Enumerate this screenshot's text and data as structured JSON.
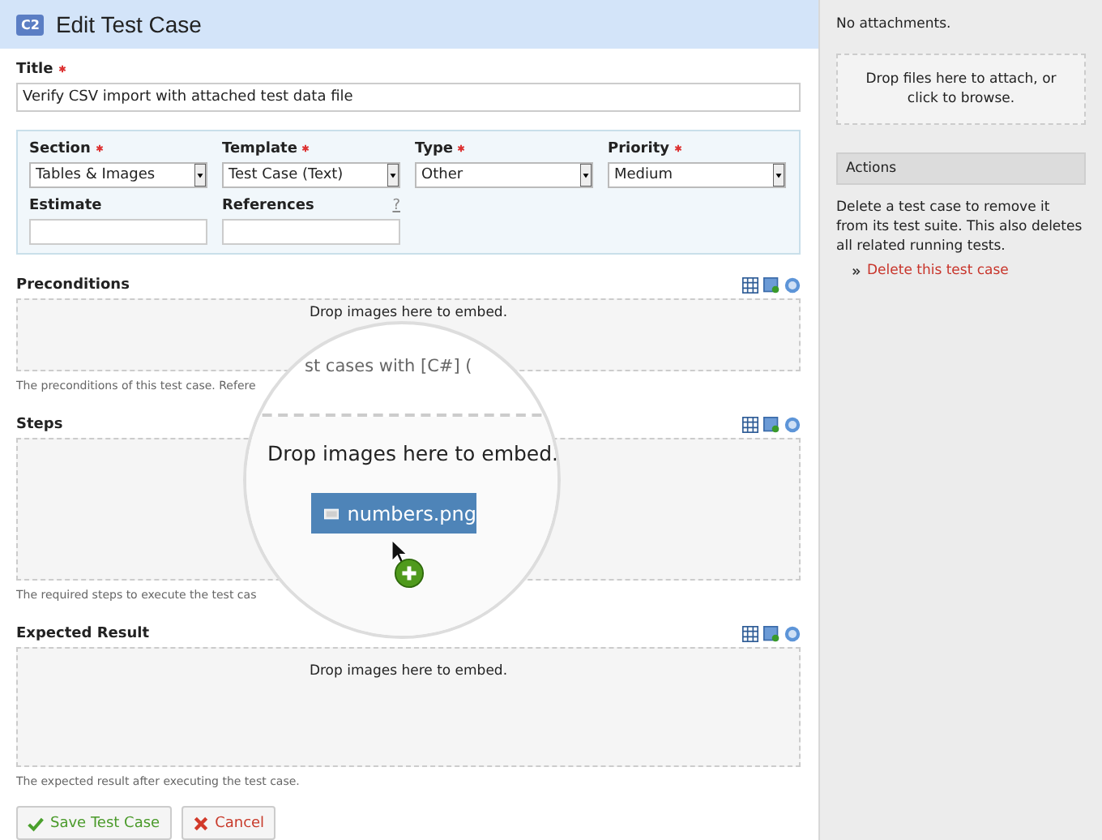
{
  "header": {
    "badge": "C2",
    "title": "Edit Test Case"
  },
  "title_field": {
    "label": "Title",
    "required": true,
    "value": "Verify CSV import with attached test data file"
  },
  "fields": [
    {
      "label": "Section",
      "required": true,
      "kind": "select",
      "value": "Tables & Images"
    },
    {
      "label": "Template",
      "required": true,
      "kind": "select",
      "value": "Test Case (Text)"
    },
    {
      "label": "Type",
      "required": true,
      "kind": "select",
      "value": "Other"
    },
    {
      "label": "Priority",
      "required": true,
      "kind": "select",
      "value": "Medium"
    },
    {
      "label": "Estimate",
      "kind": "text"
    },
    {
      "label": "References",
      "kind": "text",
      "help": "?"
    }
  ],
  "editors": [
    {
      "label": "Preconditions",
      "drop_text": "Drop images here to embed.",
      "hint": "The preconditions of this test case. Refere"
    },
    {
      "label": "Steps",
      "hint": "The required steps to execute the test cas"
    },
    {
      "label": "Expected Result",
      "drop_text": "Drop images here to embed.",
      "hint": "The expected result after executing the test case."
    }
  ],
  "magnifier": {
    "context_text": "st cases with [C#] (",
    "drop_text": "Drop images here to embed.",
    "file_chip": "numbers.png"
  },
  "buttons": [
    {
      "label": "Save Test Case",
      "kind": "save"
    },
    {
      "label": "Cancel",
      "kind": "cancel"
    }
  ],
  "sidebar": {
    "attachments_text": "No attachments.",
    "dropzone_text": "Drop files here to attach, or click to browse.",
    "actions_title": "Actions",
    "actions_text": "Delete a test case to remove it from its test suite. This also deletes all related running tests.",
    "delete_link": "Delete this test case"
  }
}
